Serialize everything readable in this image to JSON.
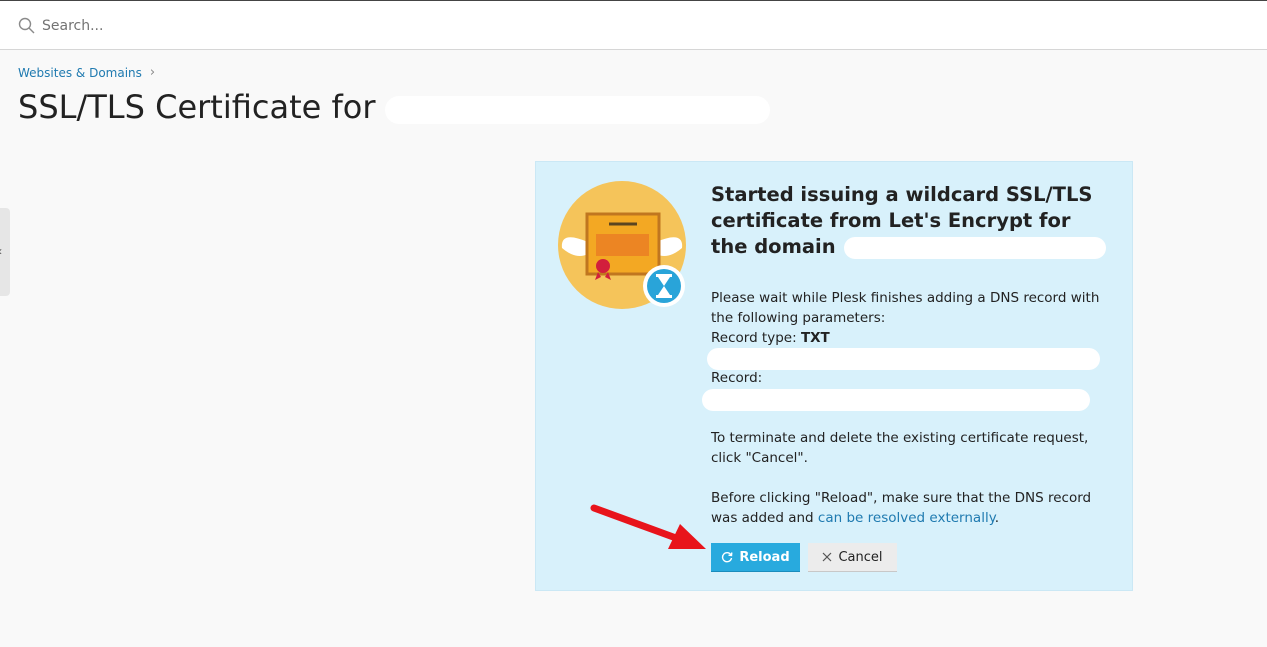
{
  "search": {
    "placeholder": "Search..."
  },
  "breadcrumb": {
    "item": "Websites & Domains",
    "separator": "›"
  },
  "page": {
    "title": "SSL/TLS Certificate for"
  },
  "panel": {
    "title": "Started issuing a wildcard SSL/TLS certificate from Let's Encrypt for the domain",
    "intro": "Please wait while Plesk finishes adding a DNS record with the following parameters:",
    "record_type_label": "Record type:",
    "record_type_value": "TXT",
    "record_label": "Record:",
    "terminate_text": "To terminate and delete the existing certificate request, click \"Cancel\".",
    "before_text": "Before clicking \"Reload\", make sure that the DNS record was added and",
    "before_link": "can be resolved externally",
    "before_end": "."
  },
  "buttons": {
    "reload": "Reload",
    "cancel": "Cancel"
  },
  "colors": {
    "accent": "#28aade",
    "panel_bg": "#d8f1fb",
    "link": "#1f7ab0",
    "arrow": "#e8141b"
  },
  "icons": [
    "search-icon",
    "chevron-right-icon",
    "certificate-illustration",
    "hourglass-icon",
    "refresh-icon",
    "close-icon",
    "red-arrow"
  ]
}
